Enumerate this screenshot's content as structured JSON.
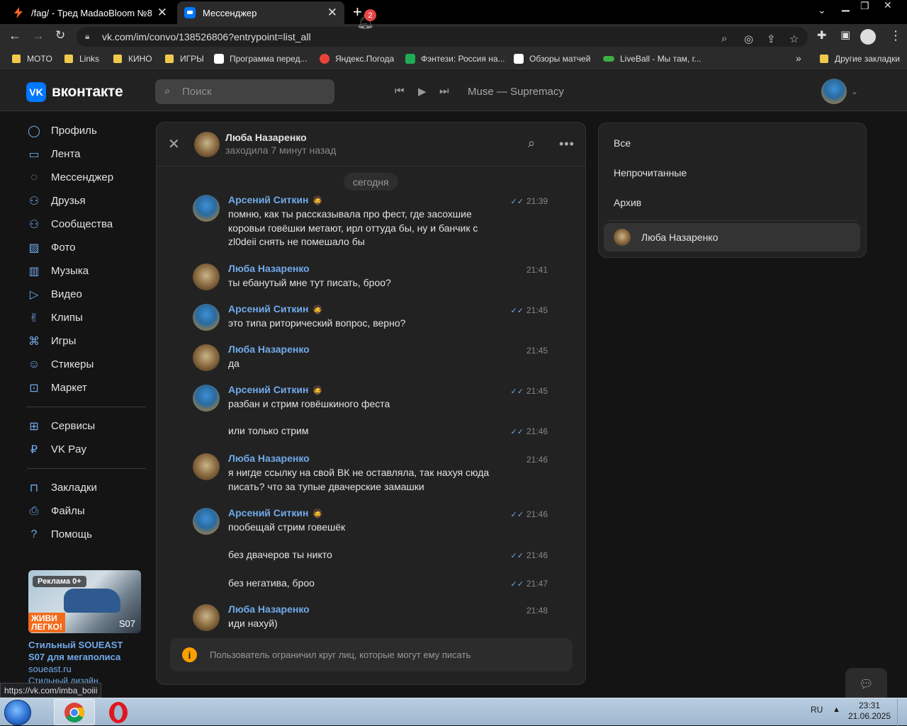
{
  "browser": {
    "tabs": [
      {
        "title": "/fag/ - Тред MadaoBloom №8"
      },
      {
        "title": "Мессенджер"
      }
    ],
    "new_tab": "+",
    "address": "vk.com/im/convo/138526806?entrypoint=list_all",
    "bookmarks": [
      {
        "label": "MOTO",
        "icon": "folder-icon"
      },
      {
        "label": "Links",
        "icon": "folder-icon"
      },
      {
        "label": "КИНО",
        "icon": "folder-icon"
      },
      {
        "label": "ИГРЫ",
        "icon": "folder-icon"
      },
      {
        "label": "Программа перед...",
        "icon": "tv-program-icon"
      },
      {
        "label": "Яндекс.Погода",
        "icon": "yandex-weather-icon"
      },
      {
        "label": "Фэнтези: Россия на...",
        "icon": "fantasy-icon"
      },
      {
        "label": "Обзоры матчей",
        "icon": "match-review-icon"
      },
      {
        "label": "LiveBall - Мы там, г...",
        "icon": "liveball-icon"
      }
    ],
    "bookmarks_overflow": "»",
    "other_bookmarks": "Другие закладки",
    "status_url": "https://vk.com/imba_boiii"
  },
  "vk_header": {
    "logo_text": "вконтакте",
    "logo_mark": "VK",
    "search_placeholder": "Поиск",
    "notifications_count": "2",
    "now_playing": "Muse — Supremacy"
  },
  "left_nav": {
    "items": [
      {
        "label": "Профиль",
        "icon": "profile-icon"
      },
      {
        "label": "Лента",
        "icon": "feed-icon"
      },
      {
        "label": "Мессенджер",
        "icon": "messenger-icon"
      },
      {
        "label": "Друзья",
        "icon": "friends-icon"
      },
      {
        "label": "Сообщества",
        "icon": "communities-icon"
      },
      {
        "label": "Фото",
        "icon": "photo-icon"
      },
      {
        "label": "Музыка",
        "icon": "music-icon"
      },
      {
        "label": "Видео",
        "icon": "video-icon"
      },
      {
        "label": "Клипы",
        "icon": "clips-icon"
      },
      {
        "label": "Игры",
        "icon": "games-icon"
      },
      {
        "label": "Стикеры",
        "icon": "stickers-icon"
      },
      {
        "label": "Маркет",
        "icon": "market-icon"
      }
    ],
    "items2": [
      {
        "label": "Сервисы",
        "icon": "services-icon"
      },
      {
        "label": "VK Pay",
        "icon": "vkpay-icon"
      }
    ],
    "items3": [
      {
        "label": "Закладки",
        "icon": "bookmarks-icon"
      },
      {
        "label": "Файлы",
        "icon": "files-icon"
      },
      {
        "label": "Помощь",
        "icon": "help-icon"
      }
    ]
  },
  "ad": {
    "tag": "Реклама 0+",
    "image_slogan_line1": "ЖИВИ",
    "image_slogan_line2": "ЛЕГКО!",
    "image_model": "S07",
    "title": "Стильный SOUEAST S07 для мегаполиса",
    "domain": "soueast.ru",
    "text": "Стильный дизайн,"
  },
  "chat": {
    "name": "Люба Назаренко",
    "status": "заходила 7 минут назад",
    "date_divider": "сегодня",
    "messages": [
      {
        "author": "Арсений Ситкин",
        "time": "21:39",
        "text": "помню, как ты рассказывала про фест, где засохшие коровьи говёшки метают, ирл оттуда бы, ну и банчик с zl0deii снять не помешало бы"
      },
      {
        "author": "Люба Назаренко",
        "time": "21:41",
        "text": "ты ебанутый мне тут писать, броо?"
      },
      {
        "author": "Арсений Ситкин",
        "time": "21:45",
        "text": "это типа риторический вопрос, верно?"
      },
      {
        "author": "Люба Назаренко",
        "time": "21:45",
        "text": "да"
      },
      {
        "author": "Арсений Ситкин",
        "time": "21:45",
        "text": "разбан и стрим говёшкиного феста"
      },
      {
        "author": "",
        "time": "21:46",
        "text": "или только стрим"
      },
      {
        "author": "Люба Назаренко",
        "time": "21:46",
        "text": "я нигде ссылку на свой ВК не оставляла, так нахуя сюда писать? что за тупые двачерские замашки"
      },
      {
        "author": "Арсений Ситкин",
        "time": "21:46",
        "text": "пообещай стрим говешёк"
      },
      {
        "author": "",
        "time": "21:46",
        "text": "без двачеров ты никто"
      },
      {
        "author": "",
        "time": "21:47",
        "text": "без негатива, броо"
      },
      {
        "author": "Люба Назаренко",
        "time": "21:48",
        "text": "иди нахуй)"
      }
    ],
    "restriction_notice": "Пользователь ограничил круг лиц, которые могут ему писать"
  },
  "right_panel": {
    "filters": [
      "Все",
      "Непрочитанные",
      "Архив"
    ],
    "active_chat": "Люба Назаренко"
  },
  "taskbar": {
    "lang": "RU",
    "time": "23:31",
    "date": "21.06.2025"
  },
  "colors": {
    "accent": "#71aaeb",
    "vk_blue": "#0077ff",
    "background": "#141414",
    "panel": "#222222",
    "badge_red": "#e64646",
    "warning": "#ffa000"
  }
}
